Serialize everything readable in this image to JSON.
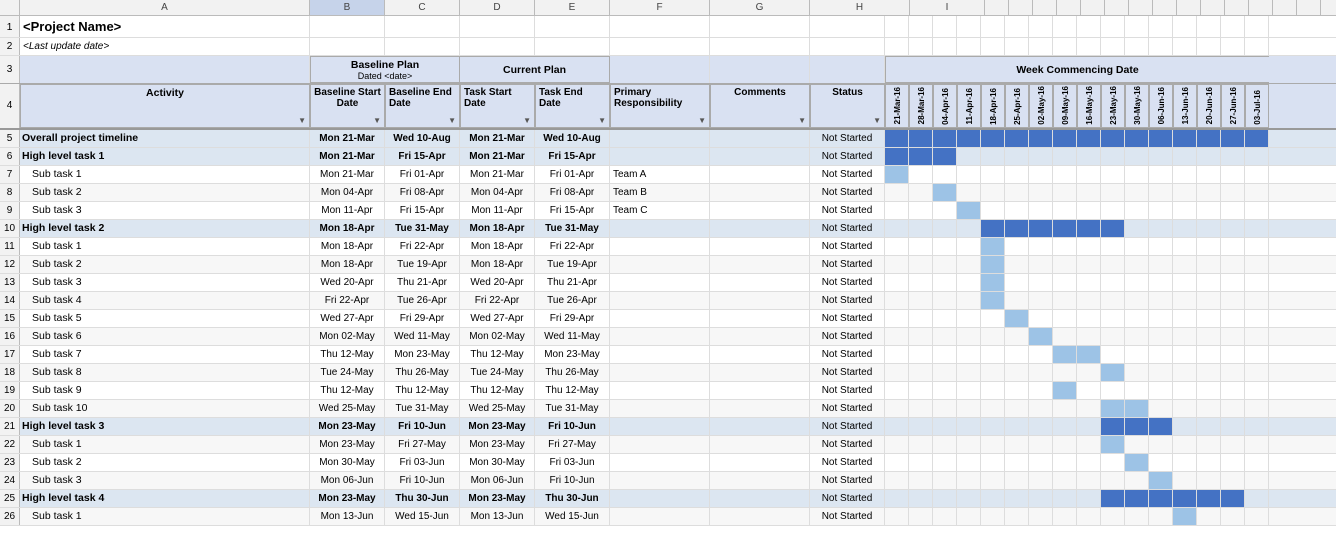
{
  "title": "<Project Name>",
  "last_update": "<Last update date>",
  "headers": {
    "baseline_plan": "Baseline Plan",
    "baseline_plan_sub": "Dated <date>",
    "current_plan": "Current Plan",
    "week_commencing": "Week Commencing Date"
  },
  "col_letters": [
    "A",
    "B",
    "C",
    "D",
    "E",
    "F",
    "G",
    "H",
    "I",
    "",
    "",
    "",
    "",
    "",
    "",
    "",
    "",
    "",
    "",
    "",
    "",
    "",
    "",
    "",
    "",
    "",
    "",
    "",
    "",
    "",
    "",
    "",
    "",
    ""
  ],
  "col_headers": {
    "activity": "Activity",
    "baseline_start": "Baseline Start Date",
    "baseline_end": "Baseline End Date",
    "task_start": "Task Start Date",
    "task_end": "Task End Date",
    "primary_resp": "Primary Responsibility",
    "comments": "Comments",
    "status": "Status"
  },
  "week_dates": [
    "21-Mar-16",
    "28-Mar-16",
    "04-Apr-16",
    "11-Apr-16",
    "18-Apr-16",
    "25-Apr-16",
    "02-May-16",
    "09-May-16",
    "16-May-16",
    "23-May-16",
    "30-May-16",
    "06-Jun-16",
    "13-Jun-16",
    "20-Jun-16",
    "27-Jun-16",
    "03-Jul-16"
  ],
  "rows": [
    {
      "num": 5,
      "activity": "Overall project timeline",
      "bs": "Mon 21-Mar",
      "be": "Wed 10-Aug",
      "ts": "Mon 21-Mar",
      "te": "Wed 10-Aug",
      "resp": "",
      "comments": "",
      "status": "Not Started",
      "type": "overall",
      "gantt": [
        1,
        1,
        1,
        1,
        1,
        1,
        1,
        1,
        1,
        1,
        1,
        1,
        1,
        1,
        1,
        1
      ]
    },
    {
      "num": 6,
      "activity": "High level task 1",
      "bs": "Mon 21-Mar",
      "be": "Fri 15-Apr",
      "ts": "Mon 21-Mar",
      "te": "Fri 15-Apr",
      "resp": "",
      "comments": "",
      "status": "Not Started",
      "type": "highlevel",
      "gantt": [
        1,
        1,
        1,
        0,
        0,
        0,
        0,
        0,
        0,
        0,
        0,
        0,
        0,
        0,
        0,
        0
      ]
    },
    {
      "num": 7,
      "activity": "Sub task 1",
      "bs": "Mon 21-Mar",
      "be": "Fri 01-Apr",
      "ts": "Mon 21-Mar",
      "te": "Fri 01-Apr",
      "resp": "Team A",
      "comments": "",
      "status": "Not Started",
      "type": "subtask",
      "gantt": [
        1,
        0,
        0,
        0,
        0,
        0,
        0,
        0,
        0,
        0,
        0,
        0,
        0,
        0,
        0,
        0
      ]
    },
    {
      "num": 8,
      "activity": "Sub task 2",
      "bs": "Mon 04-Apr",
      "be": "Fri 08-Apr",
      "ts": "Mon 04-Apr",
      "te": "Fri 08-Apr",
      "resp": "Team B",
      "comments": "",
      "status": "Not Started",
      "type": "subtask",
      "gantt": [
        0,
        0,
        1,
        0,
        0,
        0,
        0,
        0,
        0,
        0,
        0,
        0,
        0,
        0,
        0,
        0
      ]
    },
    {
      "num": 9,
      "activity": "Sub task 3",
      "bs": "Mon 11-Apr",
      "be": "Fri 15-Apr",
      "ts": "Mon 11-Apr",
      "te": "Fri 15-Apr",
      "resp": "Team C",
      "comments": "",
      "status": "Not Started",
      "type": "subtask",
      "gantt": [
        0,
        0,
        0,
        1,
        0,
        0,
        0,
        0,
        0,
        0,
        0,
        0,
        0,
        0,
        0,
        0
      ]
    },
    {
      "num": 10,
      "activity": "High level task 2",
      "bs": "Mon 18-Apr",
      "be": "Tue 31-May",
      "ts": "Mon 18-Apr",
      "te": "Tue 31-May",
      "resp": "",
      "comments": "",
      "status": "Not Started",
      "type": "highlevel",
      "gantt": [
        0,
        0,
        0,
        0,
        1,
        1,
        1,
        1,
        1,
        1,
        0,
        0,
        0,
        0,
        0,
        0
      ]
    },
    {
      "num": 11,
      "activity": "Sub task 1",
      "bs": "Mon 18-Apr",
      "be": "Fri 22-Apr",
      "ts": "Mon 18-Apr",
      "te": "Fri 22-Apr",
      "resp": "",
      "comments": "",
      "status": "Not Started",
      "type": "subtask",
      "gantt": [
        0,
        0,
        0,
        0,
        1,
        0,
        0,
        0,
        0,
        0,
        0,
        0,
        0,
        0,
        0,
        0
      ]
    },
    {
      "num": 12,
      "activity": "Sub task 2",
      "bs": "Mon 18-Apr",
      "be": "Tue 19-Apr",
      "ts": "Mon 18-Apr",
      "te": "Tue 19-Apr",
      "resp": "",
      "comments": "",
      "status": "Not Started",
      "type": "subtask",
      "gantt": [
        0,
        0,
        0,
        0,
        1,
        0,
        0,
        0,
        0,
        0,
        0,
        0,
        0,
        0,
        0,
        0
      ]
    },
    {
      "num": 13,
      "activity": "Sub task 3",
      "bs": "Wed 20-Apr",
      "be": "Thu 21-Apr",
      "ts": "Wed 20-Apr",
      "te": "Thu 21-Apr",
      "resp": "",
      "comments": "",
      "status": "Not Started",
      "type": "subtask",
      "gantt": [
        0,
        0,
        0,
        0,
        1,
        0,
        0,
        0,
        0,
        0,
        0,
        0,
        0,
        0,
        0,
        0
      ]
    },
    {
      "num": 14,
      "activity": "Sub task 4",
      "bs": "Fri 22-Apr",
      "be": "Tue 26-Apr",
      "ts": "Fri 22-Apr",
      "te": "Tue 26-Apr",
      "resp": "",
      "comments": "",
      "status": "Not Started",
      "type": "subtask",
      "gantt": [
        0,
        0,
        0,
        0,
        1,
        0,
        0,
        0,
        0,
        0,
        0,
        0,
        0,
        0,
        0,
        0
      ]
    },
    {
      "num": 15,
      "activity": "Sub task 5",
      "bs": "Wed 27-Apr",
      "be": "Fri 29-Apr",
      "ts": "Wed 27-Apr",
      "te": "Fri 29-Apr",
      "resp": "",
      "comments": "",
      "status": "Not Started",
      "type": "subtask",
      "gantt": [
        0,
        0,
        0,
        0,
        0,
        1,
        0,
        0,
        0,
        0,
        0,
        0,
        0,
        0,
        0,
        0
      ]
    },
    {
      "num": 16,
      "activity": "Sub task 6",
      "bs": "Mon 02-May",
      "be": "Wed 11-May",
      "ts": "Mon 02-May",
      "te": "Wed 11-May",
      "resp": "",
      "comments": "",
      "status": "Not Started",
      "type": "subtask",
      "gantt": [
        0,
        0,
        0,
        0,
        0,
        0,
        1,
        0,
        0,
        0,
        0,
        0,
        0,
        0,
        0,
        0
      ]
    },
    {
      "num": 17,
      "activity": "Sub task 7",
      "bs": "Thu 12-May",
      "be": "Mon 23-May",
      "ts": "Thu 12-May",
      "te": "Mon 23-May",
      "resp": "",
      "comments": "",
      "status": "Not Started",
      "type": "subtask",
      "gantt": [
        0,
        0,
        0,
        0,
        0,
        0,
        0,
        1,
        1,
        0,
        0,
        0,
        0,
        0,
        0,
        0
      ]
    },
    {
      "num": 18,
      "activity": "Sub task 8",
      "bs": "Tue 24-May",
      "be": "Thu 26-May",
      "ts": "Tue 24-May",
      "te": "Thu 26-May",
      "resp": "",
      "comments": "",
      "status": "Not Started",
      "type": "subtask",
      "gantt": [
        0,
        0,
        0,
        0,
        0,
        0,
        0,
        0,
        0,
        1,
        0,
        0,
        0,
        0,
        0,
        0
      ]
    },
    {
      "num": 19,
      "activity": "Sub task 9",
      "bs": "Thu 12-May",
      "be": "Thu 12-May",
      "ts": "Thu 12-May",
      "te": "Thu 12-May",
      "resp": "",
      "comments": "",
      "status": "Not Started",
      "type": "subtask",
      "gantt": [
        0,
        0,
        0,
        0,
        0,
        0,
        0,
        1,
        0,
        0,
        0,
        0,
        0,
        0,
        0,
        0
      ]
    },
    {
      "num": 20,
      "activity": "Sub task 10",
      "bs": "Wed 25-May",
      "be": "Tue 31-May",
      "ts": "Wed 25-May",
      "te": "Tue 31-May",
      "resp": "",
      "comments": "",
      "status": "Not Started",
      "type": "subtask",
      "gantt": [
        0,
        0,
        0,
        0,
        0,
        0,
        0,
        0,
        0,
        1,
        1,
        0,
        0,
        0,
        0,
        0
      ]
    },
    {
      "num": 21,
      "activity": "High level task 3",
      "bs": "Mon 23-May",
      "be": "Fri 10-Jun",
      "ts": "Mon 23-May",
      "te": "Fri 10-Jun",
      "resp": "",
      "comments": "",
      "status": "Not Started",
      "type": "highlevel",
      "gantt": [
        0,
        0,
        0,
        0,
        0,
        0,
        0,
        0,
        0,
        1,
        1,
        1,
        0,
        0,
        0,
        0
      ]
    },
    {
      "num": 22,
      "activity": "Sub task 1",
      "bs": "Mon 23-May",
      "be": "Fri 27-May",
      "ts": "Mon 23-May",
      "te": "Fri 27-May",
      "resp": "",
      "comments": "",
      "status": "Not Started",
      "type": "subtask",
      "gantt": [
        0,
        0,
        0,
        0,
        0,
        0,
        0,
        0,
        0,
        1,
        0,
        0,
        0,
        0,
        0,
        0
      ]
    },
    {
      "num": 23,
      "activity": "Sub task 2",
      "bs": "Mon 30-May",
      "be": "Fri 03-Jun",
      "ts": "Mon 30-May",
      "te": "Fri 03-Jun",
      "resp": "",
      "comments": "",
      "status": "Not Started",
      "type": "subtask",
      "gantt": [
        0,
        0,
        0,
        0,
        0,
        0,
        0,
        0,
        0,
        0,
        1,
        0,
        0,
        0,
        0,
        0
      ]
    },
    {
      "num": 24,
      "activity": "Sub task 3",
      "bs": "Mon 06-Jun",
      "be": "Fri 10-Jun",
      "ts": "Mon 06-Jun",
      "te": "Fri 10-Jun",
      "resp": "",
      "comments": "",
      "status": "Not Started",
      "type": "subtask",
      "gantt": [
        0,
        0,
        0,
        0,
        0,
        0,
        0,
        0,
        0,
        0,
        0,
        1,
        0,
        0,
        0,
        0
      ]
    },
    {
      "num": 25,
      "activity": "High level task 4",
      "bs": "Mon 23-May",
      "be": "Thu 30-Jun",
      "ts": "Mon 23-May",
      "te": "Thu 30-Jun",
      "resp": "",
      "comments": "",
      "status": "Not Started",
      "type": "highlevel",
      "gantt": [
        0,
        0,
        0,
        0,
        0,
        0,
        0,
        0,
        0,
        1,
        1,
        1,
        1,
        1,
        1,
        0
      ]
    },
    {
      "num": 26,
      "activity": "Sub task 1",
      "bs": "Mon 13-Jun",
      "be": "Wed 15-Jun",
      "ts": "Mon 13-Jun",
      "te": "Wed 15-Jun",
      "resp": "",
      "comments": "",
      "status": "Not Started",
      "type": "subtask",
      "gantt": [
        0,
        0,
        0,
        0,
        0,
        0,
        0,
        0,
        0,
        0,
        0,
        0,
        1,
        0,
        0,
        0
      ]
    }
  ],
  "status_label": "Not Started"
}
